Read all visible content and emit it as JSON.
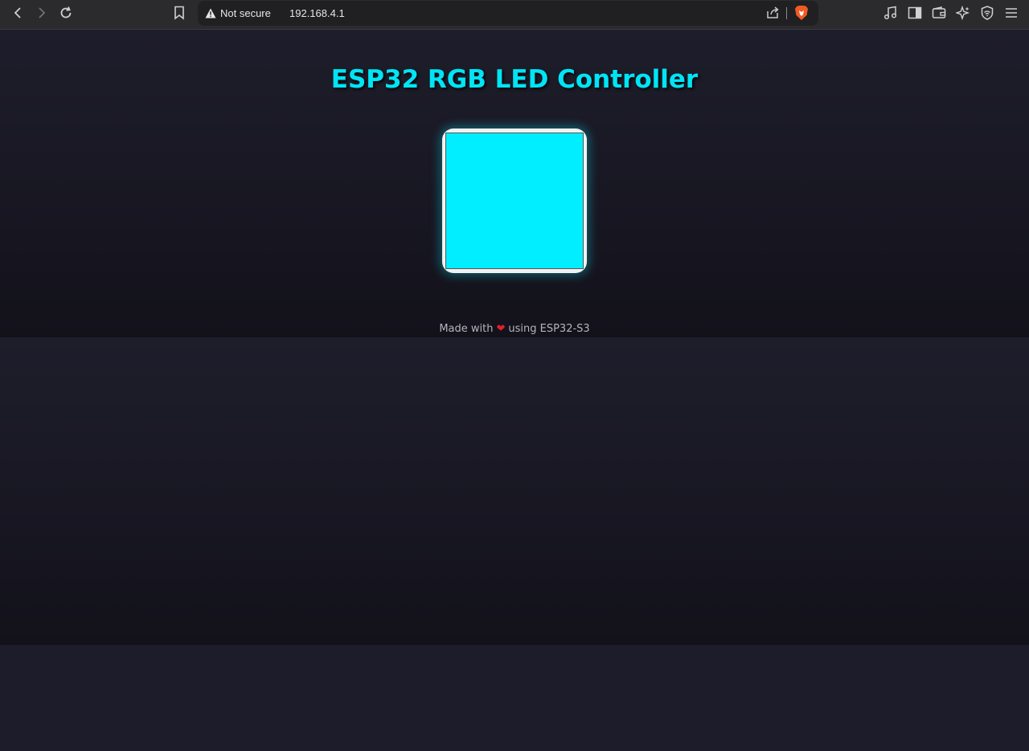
{
  "browser": {
    "security_label": "Not secure",
    "url": "192.168.4.1",
    "icons": [
      "back-icon",
      "forward-icon",
      "reload-icon",
      "bookmark-icon",
      "warning-icon",
      "share-icon",
      "brave-lion-icon",
      "music-icon",
      "sidebar-icon",
      "wallet-icon",
      "leo-ai-icon",
      "vpn-shield-icon",
      "menu-icon"
    ]
  },
  "page": {
    "title": "ESP32 RGB LED Controller",
    "color_value": "#00eeff",
    "footer_prefix": "Made with",
    "footer_heart": "❤",
    "footer_suffix": "using ESP32-S3"
  },
  "colors": {
    "accent": "#00e5f5",
    "heart": "#e0202a",
    "background": "#1d1c2a"
  }
}
